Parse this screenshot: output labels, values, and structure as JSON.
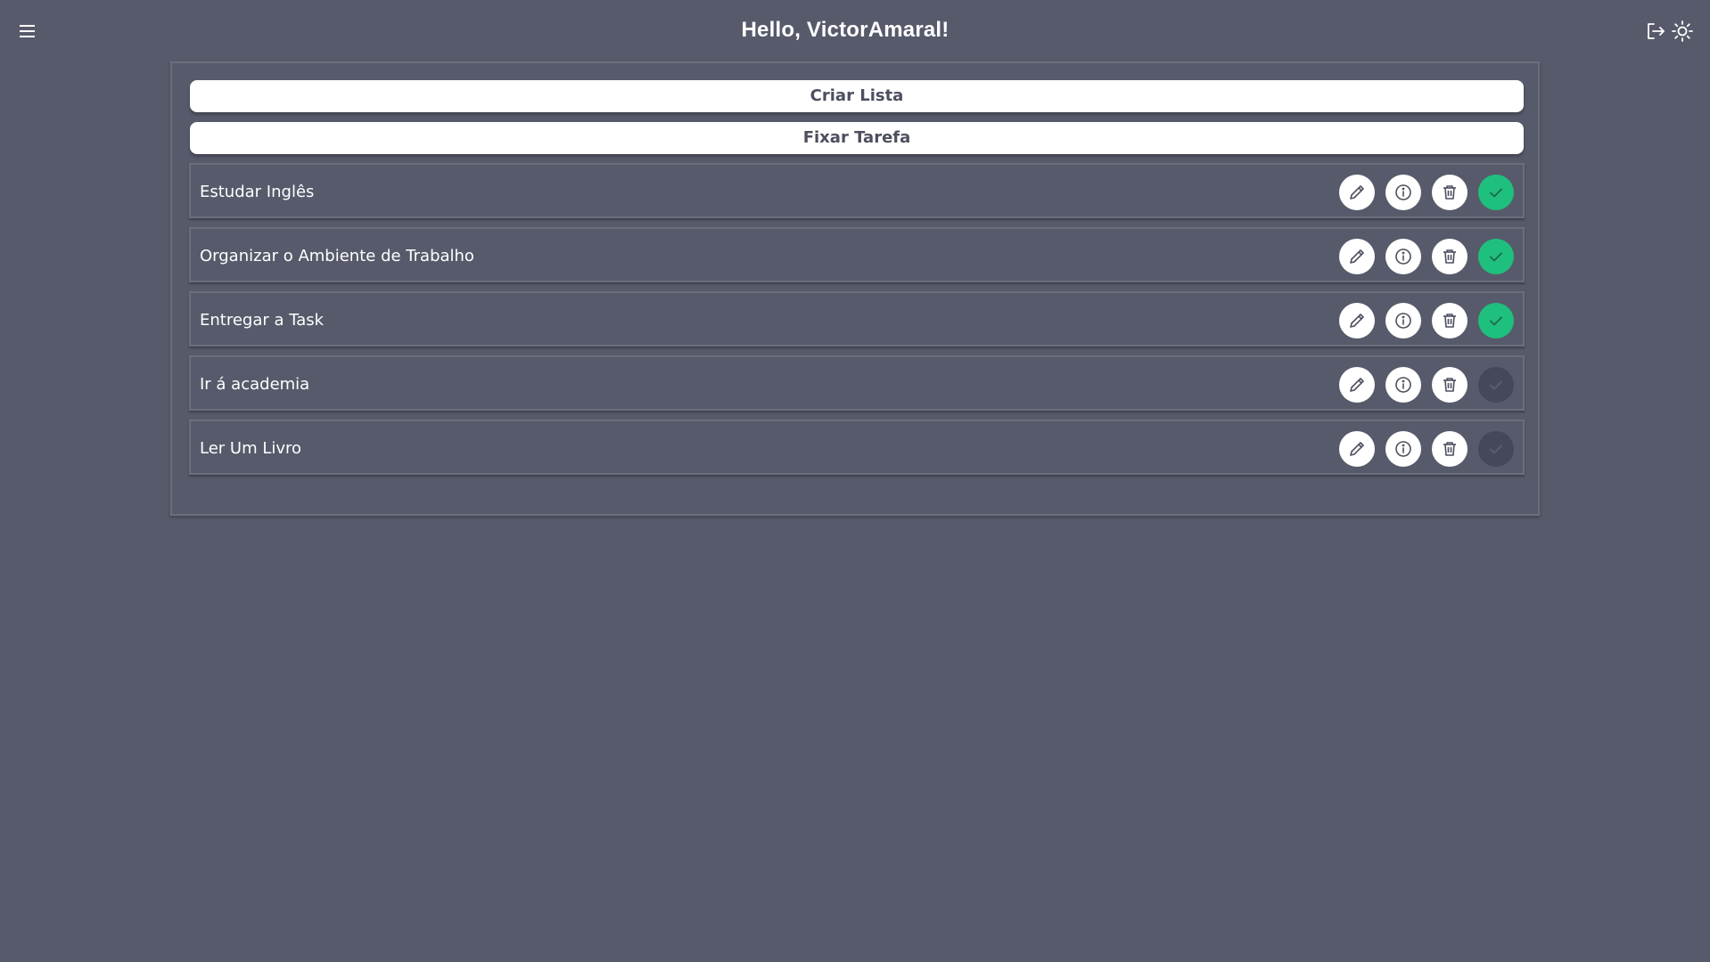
{
  "header": {
    "greeting": "Hello, VictorAmaral!"
  },
  "buttons": {
    "create_list": "Criar Lista",
    "pin_task": "Fixar Tarefa"
  },
  "tasks": [
    {
      "name": "Estudar Inglês",
      "completed": true
    },
    {
      "name": "Organizar o Ambiente de Trabalho",
      "completed": true
    },
    {
      "name": "Entregar a Task",
      "completed": true
    },
    {
      "name": "Ir á academia",
      "completed": false
    },
    {
      "name": "Ler Um Livro",
      "completed": false
    }
  ],
  "colors": {
    "background": "#575a6b",
    "completed": "#1fbf7d",
    "pending": "#45475a",
    "button_bg": "#ffffff",
    "button_text": "#4c4f5e"
  },
  "icons": {
    "menu": "hamburger-menu-icon",
    "logout": "logout-icon",
    "theme": "sun-icon",
    "edit": "pencil-icon",
    "info": "info-icon",
    "delete": "trash-icon",
    "complete": "check-icon"
  }
}
